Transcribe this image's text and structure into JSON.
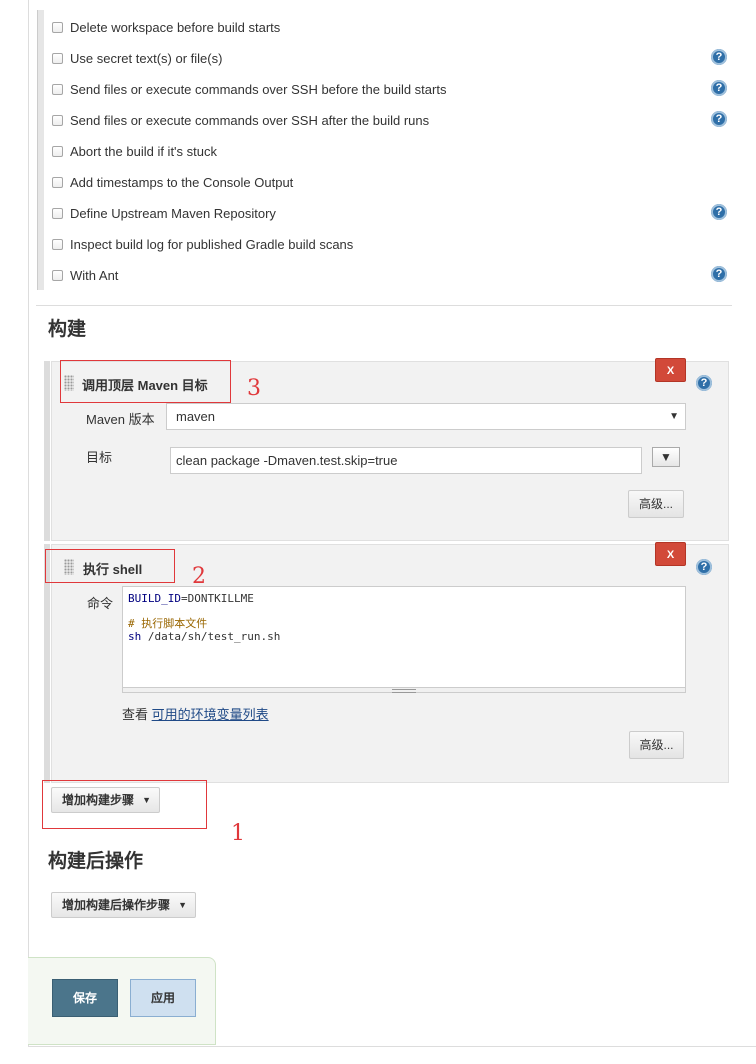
{
  "env_options": [
    {
      "label": "Delete workspace before build starts",
      "help": false
    },
    {
      "label": "Use secret text(s) or file(s)",
      "help": true
    },
    {
      "label": "Send files or execute commands over SSH before the build starts",
      "help": true
    },
    {
      "label": "Send files or execute commands over SSH after the build runs",
      "help": true
    },
    {
      "label": "Abort the build if it's stuck",
      "help": false
    },
    {
      "label": "Add timestamps to the Console Output",
      "help": false
    },
    {
      "label": "Define Upstream Maven Repository",
      "help": true
    },
    {
      "label": "Inspect build log for published Gradle build scans",
      "help": false
    },
    {
      "label": "With Ant",
      "help": true
    }
  ],
  "help_glyph": "?",
  "build": {
    "section_title": "构建",
    "maven_step": {
      "title": "调用顶层 Maven 目标",
      "delete_label": "X",
      "version_label": "Maven 版本",
      "version_value": "maven",
      "goals_label": "目标",
      "goals_value": "clean package -Dmaven.test.skip=true",
      "expand_glyph": "▼",
      "advanced_label": "高级..."
    },
    "shell_step": {
      "title": "执行 shell",
      "delete_label": "X",
      "command_label": "命令",
      "command_lines": [
        {
          "kw": "BUILD_ID",
          "rest": "=DONTKILLME"
        },
        {
          "text": ""
        },
        {
          "comment": "# 执行脚本文件"
        },
        {
          "kw": "sh",
          "rest": " /data/sh/test_run.sh"
        }
      ],
      "env_prefix": "查看 ",
      "env_link": "可用的环境变量列表",
      "advanced_label": "高级..."
    },
    "add_step_label": "增加构建步骤"
  },
  "post_build": {
    "section_title": "构建后操作",
    "add_step_label": "增加构建后操作步骤"
  },
  "footer": {
    "save_label": "保存",
    "apply_label": "应用"
  },
  "annotations": {
    "one": "1",
    "two": "2",
    "three": "3"
  }
}
